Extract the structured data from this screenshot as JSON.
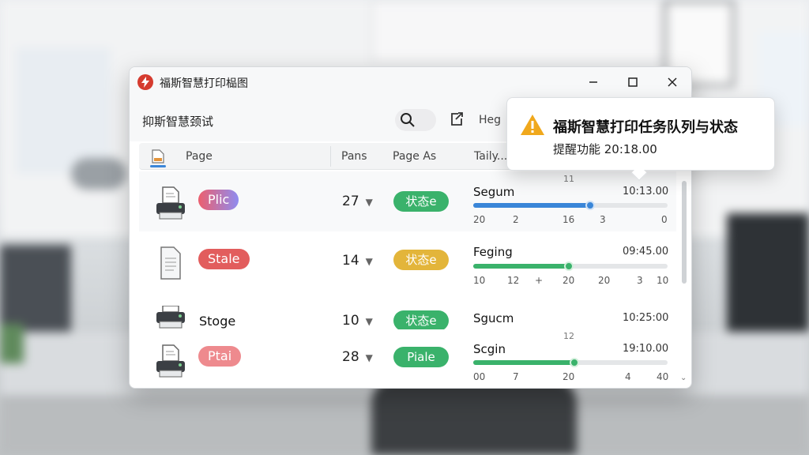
{
  "window": {
    "title": "福斯智慧打印榀图",
    "toolbar_title": "抑斯智慧颈试",
    "help_label": "Heg"
  },
  "table": {
    "headers": [
      "Page",
      "Pans",
      "Page As",
      "Taily..."
    ],
    "rows": [
      {
        "device": "printer",
        "pill": "Plic",
        "count": "27",
        "status": "状态e",
        "progress_name": "Segum",
        "progress_top": "11",
        "time": "10:13.00",
        "progress": 0.6,
        "ticks": [
          "20",
          "2",
          "16",
          "3",
          "0"
        ]
      },
      {
        "device": "document",
        "pill": "Stale",
        "count": "14",
        "status": "状态e",
        "progress_name": "Feging",
        "progress_top": "",
        "time": "09:45.00",
        "progress": 0.49,
        "ticks": [
          "10",
          "12",
          "+",
          "20",
          "20",
          "3",
          "10"
        ]
      },
      {
        "device": "printer",
        "stage": "Stoge",
        "count": "10",
        "status": "状态e",
        "progress_name": "Sgucm",
        "progress_top": "",
        "time": "10:25:00",
        "ticks": []
      },
      {
        "device": "printer",
        "pill": "Ptai",
        "count": "28",
        "status": "Piale",
        "progress_name": "Scgin",
        "progress_top": "12",
        "time": "19:10.00",
        "progress": 0.52,
        "ticks": [
          "00",
          "7",
          "20",
          "4",
          "40"
        ]
      }
    ]
  },
  "notification": {
    "title": "福斯智慧打印任务队列与状态",
    "body": "提醒功能 20:18.00"
  },
  "colors": {
    "accent_blue": "#3a86d8",
    "green": "#3ab26b",
    "yellow": "#e3b53a",
    "red": "#e25d5d",
    "warning": "#f0a81c",
    "logo_red": "#d53b2f"
  },
  "icons": {
    "logo": "app-logo-icon",
    "search": "search-icon",
    "export": "export-icon",
    "warning": "warning-icon"
  }
}
